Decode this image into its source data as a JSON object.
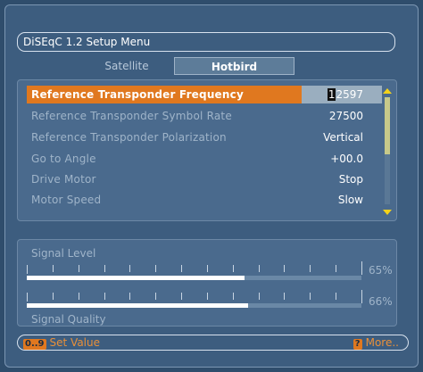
{
  "menu_title": "DiSEqC 1.2 Setup Menu",
  "tabs": [
    {
      "label": "Satellite",
      "active": false
    },
    {
      "label": "Hotbird",
      "active": true
    }
  ],
  "settings": [
    {
      "label": "Reference Transponder Frequency",
      "value": "12597",
      "cursor_char": "1",
      "value_rest": "2597",
      "selected": true
    },
    {
      "label": "Reference Transponder Symbol Rate",
      "value": "27500"
    },
    {
      "label": "Reference Transponder Polarization",
      "value": "Vertical"
    },
    {
      "label": "Go to Angle",
      "value": "+00.0"
    },
    {
      "label": "Drive Motor",
      "value": "Stop"
    },
    {
      "label": "Motor Speed",
      "value": "Slow"
    }
  ],
  "signal": {
    "level_label": "Signal Level",
    "level_percent": 65,
    "level_text": "65%",
    "quality_label": "Signal Quality",
    "quality_percent": 66,
    "quality_text": "66%"
  },
  "footer": {
    "left_key": "0..9",
    "left_label": "Set Value",
    "right_key": "?",
    "right_label": "More.."
  },
  "colors": {
    "highlight": "#e0781f",
    "scroll_arrows": "#f3d21a",
    "background": "#3d5d7f"
  }
}
